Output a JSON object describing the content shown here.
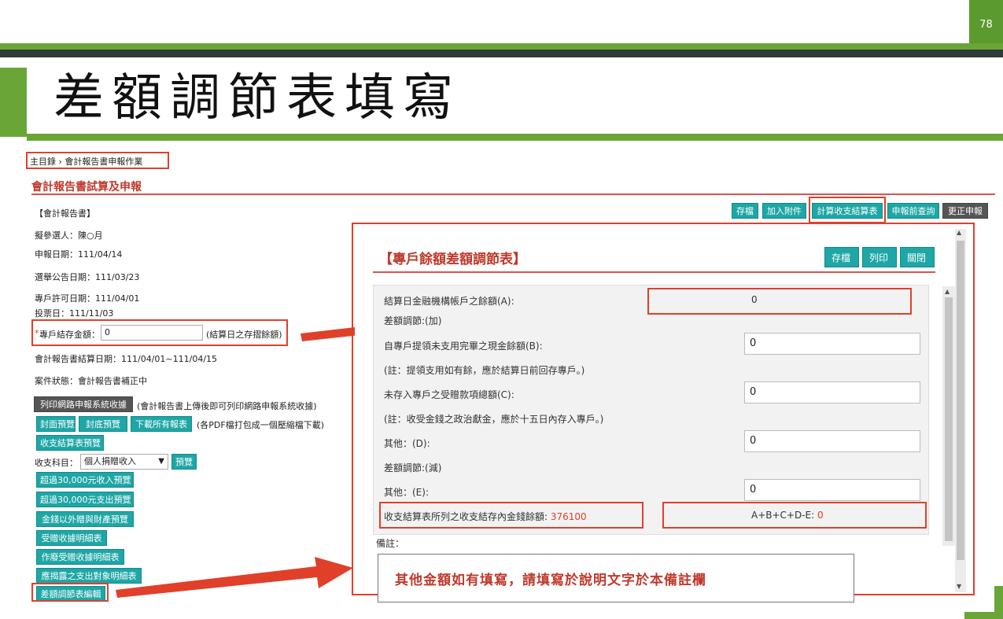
{
  "slide": {
    "page_number": "78",
    "title": "差額調節表填寫"
  },
  "breadcrumb": "主目錄 › 會計報告書申報作業",
  "section_title": "會計報告書試算及申報",
  "toolbar": {
    "save": "存檔",
    "attach": "加入附件",
    "calc": "計算收支結算表",
    "prequery": "申報前查詢",
    "correct": "更正申報"
  },
  "left": {
    "report_header": "【會計報告書】",
    "candidate": "擬參選人：陳○月",
    "report_date": "申報日期：111/04/14",
    "announce_date": "選舉公告日期：111/03/23",
    "account_date": "專戶許可日期：111/04/01",
    "vote_date": "投票日：111/11/03",
    "balance_label": "專戶結存金額：",
    "balance_required": "*",
    "balance_value": "0",
    "balance_hint": "(結算日之存摺餘額)",
    "period": "會計報告書結算日期：111/04/01~111/04/15",
    "status": "案件狀態：會計報告書補正中",
    "print_online": "列印網路申報系統收據",
    "print_online_hint": "(會計報告書上傳後即可列印網路申報系統收據)",
    "cover_preview": "封面預覽",
    "back_preview": "封底預覽",
    "download_all": "下載所有報表",
    "download_hint": "(各PDF檔打包成一個壓縮檔下載)",
    "settle_preview": "收支結算表預覽",
    "subject_label": "收支科目：",
    "subject_selected": "個人捐贈收入",
    "subject_preview": "預覽",
    "list_buttons": [
      "超過30,000元收入預覽",
      "超過30,000元支出預覽",
      "金錢以外贈與財產預覽",
      "受贈收據明細表",
      "作廢受贈收據明細表",
      "應揭露之支出對象明細表",
      "差額調節表編輯"
    ]
  },
  "modal": {
    "title": "【專戶餘額差額調節表】",
    "save": "存檔",
    "print": "列印",
    "close": "關閉",
    "row_a_label": "結算日金融機構帳戶之餘額(A):",
    "row_a_value": "0",
    "adj_plus": "差額調節:(加)",
    "row_b_label": "自專戶提領未支用完畢之現金餘額(B):",
    "row_b_value": "0",
    "note_b": "(註：提領支用如有餘，應於結算日前回存專戶。)",
    "row_c_label": "未存入專戶之受贈款項總額(C):",
    "row_c_value": "0",
    "note_c": "(註：收受金錢之政治獻金，應於十五日內存入專戶。)",
    "row_d_label": "其他：(D):",
    "row_d_value": "0",
    "adj_minus": "差額調節:(減)",
    "row_e_label": "其他：(E):",
    "row_e_value": "0",
    "settle_label": "收支結算表所列之收支結存內金錢餘額: ",
    "settle_value": "376100",
    "formula_label": "A+B+C+D-E: ",
    "formula_value": "0",
    "remark_label": "備註：",
    "remark_text": "其他金額如有填寫，請填寫於說明文字於本備註欄"
  },
  "colors": {
    "accent_green": "#6aa637",
    "teal_button": "#1fa6a6",
    "highlight_red": "#e0402a",
    "title_red": "#c0392b"
  }
}
